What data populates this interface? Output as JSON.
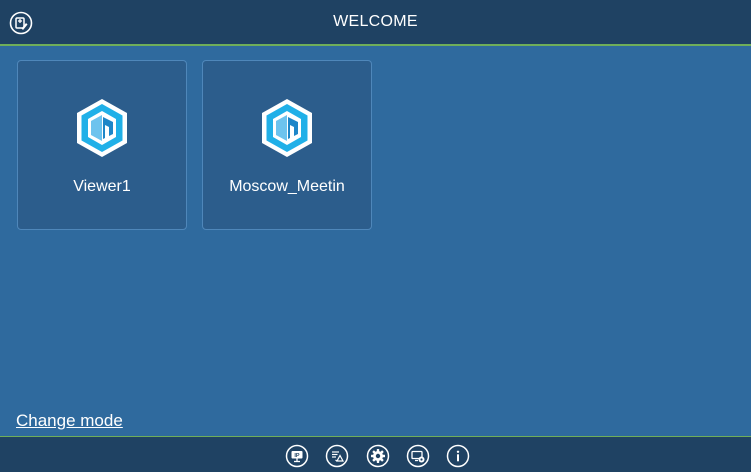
{
  "header": {
    "title": "WELCOME",
    "edit_icon": "edit-list-icon"
  },
  "rooms": [
    {
      "label": "Viewer1",
      "icon": "hexagon-logo-icon"
    },
    {
      "label": "Moscow_Meetin",
      "icon": "hexagon-logo-icon"
    }
  ],
  "footer": {
    "change_mode_label": "Change mode",
    "icons": [
      "ip-presentation-icon",
      "annotation-icon",
      "settings-gear-icon",
      "display-settings-icon",
      "info-icon"
    ]
  },
  "colors": {
    "background": "#2f6a9e",
    "bar": "#1f4263",
    "accent_line": "#6fae5a",
    "tile": "#2c5d8c",
    "logo_outer": "#20b0e8"
  }
}
